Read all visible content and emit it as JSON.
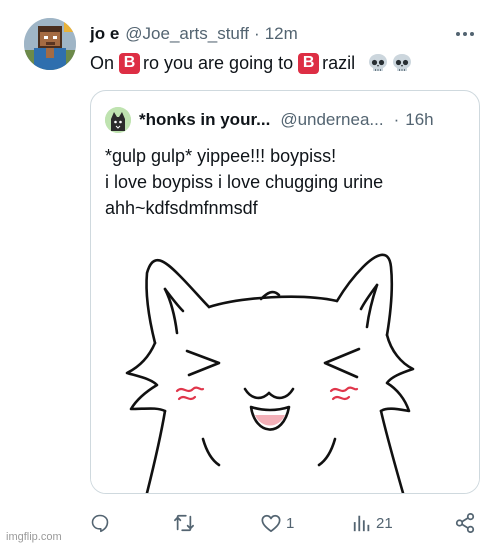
{
  "tweet": {
    "author_name": "jo e",
    "handle": "@Joe_arts_stuff",
    "separator": "·",
    "time": "12m",
    "text_parts": {
      "p1": "On",
      "b1": "B",
      "p2": "ro you are going to",
      "b2": "B",
      "p3": "razil"
    },
    "emoji_names": [
      "b-button-emoji",
      "b-button-emoji",
      "skull-emoji",
      "skull-emoji"
    ]
  },
  "quoted_tweet": {
    "author_name": "*honks in your...",
    "handle": "@undernea...",
    "separator": "·",
    "time": "16h",
    "lines": [
      "*gulp gulp* yippee!!! boypiss!",
      "i love boypiss i love chugging urine",
      "ahh~kdfsdmfnmsdf"
    ]
  },
  "actions": {
    "reply_count": "",
    "retweet_count": "",
    "like_count": "1",
    "views_count": "21"
  },
  "icons": {
    "more": "more-icon",
    "reply": "reply-icon",
    "retweet": "retweet-icon",
    "like": "heart-icon",
    "views": "views-icon",
    "share": "share-icon"
  },
  "colors": {
    "text": "#0f1419",
    "secondary": "#536471",
    "border": "#cfd9de",
    "emoji_red": "#dd2e44",
    "blush": "#e0364b"
  },
  "watermark": "imgflip.com"
}
